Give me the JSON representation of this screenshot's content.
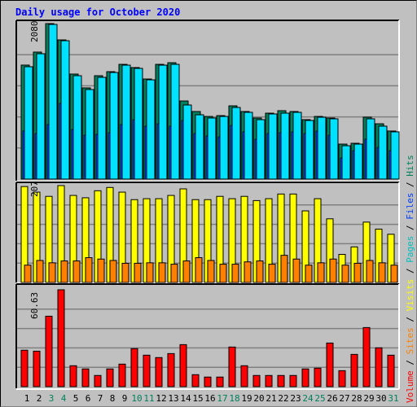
{
  "title": "Daily usage for October 2020",
  "colors": {
    "hits": "#00805c",
    "files": "#00e0ff",
    "pages": "#0040ff",
    "visits": "#ffff00",
    "sites": "#ff8000",
    "volume": "#ff0000",
    "weekend_day": "#00805c",
    "weekday": "#000000"
  },
  "legend": [
    {
      "label": "Volume",
      "color": "#ff0000"
    },
    {
      "label": " / ",
      "color": "#000000"
    },
    {
      "label": "Sites",
      "color": "#ff8000"
    },
    {
      "label": " / ",
      "color": "#000000"
    },
    {
      "label": "Visits",
      "color": "#ffff00"
    },
    {
      "label": " / ",
      "color": "#000000"
    },
    {
      "label": "Pages",
      "color": "#00c0c0"
    },
    {
      "label": " / ",
      "color": "#000000"
    },
    {
      "label": "Files",
      "color": "#0040ff"
    },
    {
      "label": " / ",
      "color": "#000000"
    },
    {
      "label": "Hits",
      "color": "#00805c"
    }
  ],
  "chart_data": [
    {
      "type": "bar",
      "title": "Hits / Files / Pages",
      "ymax_label": "2080",
      "ylim": [
        0,
        2080
      ],
      "grid": true,
      "categories": [
        "1",
        "2",
        "3",
        "4",
        "5",
        "6",
        "7",
        "8",
        "9",
        "10",
        "11",
        "12",
        "13",
        "14",
        "15",
        "16",
        "17",
        "18",
        "19",
        "20",
        "21",
        "22",
        "23",
        "24",
        "25",
        "26",
        "27",
        "28",
        "29",
        "30",
        "31"
      ],
      "series": [
        {
          "name": "Hits",
          "values": [
            1525,
            1699,
            2080,
            1862,
            1405,
            1220,
            1383,
            1437,
            1535,
            1492,
            1339,
            1535,
            1557,
            1045,
            904,
            838,
            849,
            980,
            904,
            817,
            882,
            915,
            904,
            795,
            838,
            817,
            468,
            479,
            828,
            740,
            643
          ]
        },
        {
          "name": "Files",
          "values": [
            1514,
            1688,
            2080,
            1862,
            1394,
            1209,
            1372,
            1437,
            1535,
            1492,
            1339,
            1535,
            1546,
            1002,
            871,
            828,
            849,
            969,
            904,
            806,
            882,
            893,
            904,
            795,
            838,
            817,
            457,
            479,
            817,
            719,
            643
          ]
        },
        {
          "name": "Pages",
          "values": [
            643,
            610,
            730,
            1013,
            664,
            588,
            599,
            621,
            730,
            795,
            708,
            740,
            708,
            784,
            610,
            577,
            566,
            719,
            632,
            534,
            610,
            621,
            632,
            610,
            643,
            588,
            283,
            381,
            534,
            425,
            381
          ]
        }
      ]
    },
    {
      "type": "bar",
      "title": "Visits / Sites",
      "ymax_label": "207",
      "ylim": [
        0,
        207
      ],
      "grid": true,
      "categories": [
        "1",
        "2",
        "3",
        "4",
        "5",
        "6",
        "7",
        "8",
        "9",
        "10",
        "11",
        "12",
        "13",
        "14",
        "15",
        "16",
        "17",
        "18",
        "19",
        "20",
        "21",
        "22",
        "23",
        "24",
        "25",
        "26",
        "27",
        "28",
        "29",
        "30",
        "31"
      ],
      "series": [
        {
          "name": "Visits",
          "values": [
            205,
            193,
            184,
            207,
            186,
            181,
            196,
            203,
            193,
            177,
            179,
            179,
            186,
            200,
            177,
            177,
            184,
            179,
            184,
            175,
            179,
            189,
            189,
            153,
            179,
            136,
            60,
            76,
            129,
            114,
            103
          ]
        },
        {
          "name": "Sites",
          "values": [
            37,
            47,
            42,
            46,
            46,
            53,
            50,
            47,
            41,
            41,
            42,
            42,
            39,
            46,
            53,
            47,
            39,
            39,
            44,
            46,
            39,
            58,
            50,
            37,
            42,
            50,
            37,
            41,
            47,
            42,
            37
          ]
        }
      ]
    },
    {
      "type": "bar",
      "title": "Volume",
      "ymax_label": "60.63",
      "ylim": [
        0,
        60.63
      ],
      "grid": true,
      "categories": [
        "1",
        "2",
        "3",
        "4",
        "5",
        "6",
        "7",
        "8",
        "9",
        "10",
        "11",
        "12",
        "13",
        "14",
        "15",
        "16",
        "17",
        "18",
        "19",
        "20",
        "21",
        "22",
        "23",
        "24",
        "25",
        "26",
        "27",
        "28",
        "29",
        "30",
        "31"
      ],
      "weekend": [
        "3",
        "4",
        "10",
        "11",
        "17",
        "18",
        "24",
        "25",
        "31"
      ],
      "series": [
        {
          "name": "Volume",
          "values": [
            22.8,
            22.2,
            44.1,
            60.63,
            13.1,
            11.1,
            7.0,
            11.1,
            14.1,
            23.8,
            19.7,
            18.2,
            20.7,
            26.3,
            7.5,
            6.0,
            6.0,
            24.8,
            13.1,
            7.0,
            7.0,
            7.0,
            7.0,
            11.1,
            11.6,
            27.3,
            10.0,
            20.2,
            37.0,
            24.3,
            19.7
          ]
        }
      ]
    }
  ]
}
